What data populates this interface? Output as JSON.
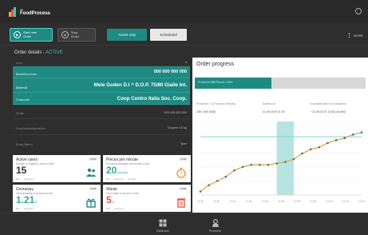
{
  "app": {
    "logo_the": "the",
    "logo_name": "FoodProcess"
  },
  "actions": {
    "start": {
      "line1": "Start new",
      "line2": "Order"
    },
    "stop": {
      "line1": "Stop",
      "line2": "Order"
    },
    "filter_active": "Active only",
    "filter_scheduled": "Scheduled",
    "more": "MORE"
  },
  "details": {
    "title": "Order details : ",
    "status": "ACTIVE",
    "rows": [
      {
        "key": "Line",
        "value": "3",
        "highlight": false
      },
      {
        "key": "Bestellnummer",
        "value": "000 000 000 000",
        "highlight": true
      },
      {
        "key": "Material",
        "value": "Mele Goden D.I ^ D.O.P. 75/80 Gialle Int.",
        "highlight": true
      },
      {
        "key": "Customer",
        "value": "Coop Centro Italia Soc. Coop.",
        "highlight": true
      },
      {
        "key": "Order",
        "value": "000 000 000 000",
        "highlight": false
      },
      {
        "key": "Productkonfiguration",
        "value": "Gropee 4.5 kg",
        "highlight": false
      },
      {
        "key": "Entry Batch",
        "value": "5per",
        "highlight": false
      }
    ]
  },
  "cards": [
    {
      "title": "Active users",
      "sub": "Number of logged in users on line",
      "value": "15",
      "unit": "",
      "foot": "Min.: ...  Last Hour: ...",
      "tag": "LIVE",
      "accent": "#1e8a82",
      "icon": "users-icon"
    },
    {
      "title": "Pieces per minute",
      "sub": "Produced packages per minute on line",
      "value": "20",
      "unit": "pcs/min",
      "foot": "Min.: ...  Last Hour: ...  Previous: ...",
      "tag": "LIVE",
      "accent": "#1e8a82",
      "icon": "stopwatch-icon"
    },
    {
      "title": "Giveaway",
      "sub": "Total giveaway in percent on line",
      "value": "1.21",
      "unit": "%",
      "foot": "Min.: ...  Last Hour: ...",
      "tag": "LIVE",
      "accent": "#1e8a82",
      "icon": "giveaway-icon"
    },
    {
      "title": "Waste",
      "sub": "Total waste in percent on line",
      "value": "5",
      "unit": "%",
      "foot": "Min.: ...  Last Hour: ...",
      "tag": "LIVE",
      "accent": "#e05a4a",
      "icon": "trash-icon"
    }
  ],
  "progress": {
    "title": "Order progress",
    "bar_label": "Produced 585 Pieces / 45%",
    "fraction": 0.45,
    "meta": [
      {
        "label": "Produced / To Produce (Pieces)",
        "value": "285 / 600 (545)"
      },
      {
        "label": "Started on",
        "value": "21.08.2019 11:30"
      },
      {
        "label": "Estimated time of completion",
        "value": "~21.08.2019 12:50 (36 Min)"
      }
    ]
  },
  "chart_data": {
    "type": "line",
    "x_labels": [
      "11:30",
      "11:35",
      "11:40",
      "11:45",
      "11:50",
      "11:55",
      "12:00",
      "12:05",
      "12:10",
      "12:15",
      "12:20"
    ],
    "series": [
      {
        "values": [
          0.5,
          1.4,
          2.0,
          2.6,
          3.5,
          4.0,
          4.3,
          4.3,
          4.3,
          4.5,
          4.7,
          5.1,
          5.9,
          6.5,
          6.8,
          7.4,
          7.8,
          8.1,
          8.6,
          8.9
        ]
      }
    ],
    "reference": {
      "value": 8.3
    },
    "highlight_band": {
      "from_index": 9,
      "to_index": 11
    },
    "ylim": [
      0,
      10
    ],
    "colors": {
      "line": "#f0a24a",
      "point": "#1e8a82",
      "reference": "#7fd8cf",
      "band": "#a9dfda"
    }
  },
  "bottom_nav": [
    {
      "label": "Dashboard",
      "icon": "dashboard-icon"
    },
    {
      "label": "Production",
      "icon": "production-icon"
    }
  ]
}
